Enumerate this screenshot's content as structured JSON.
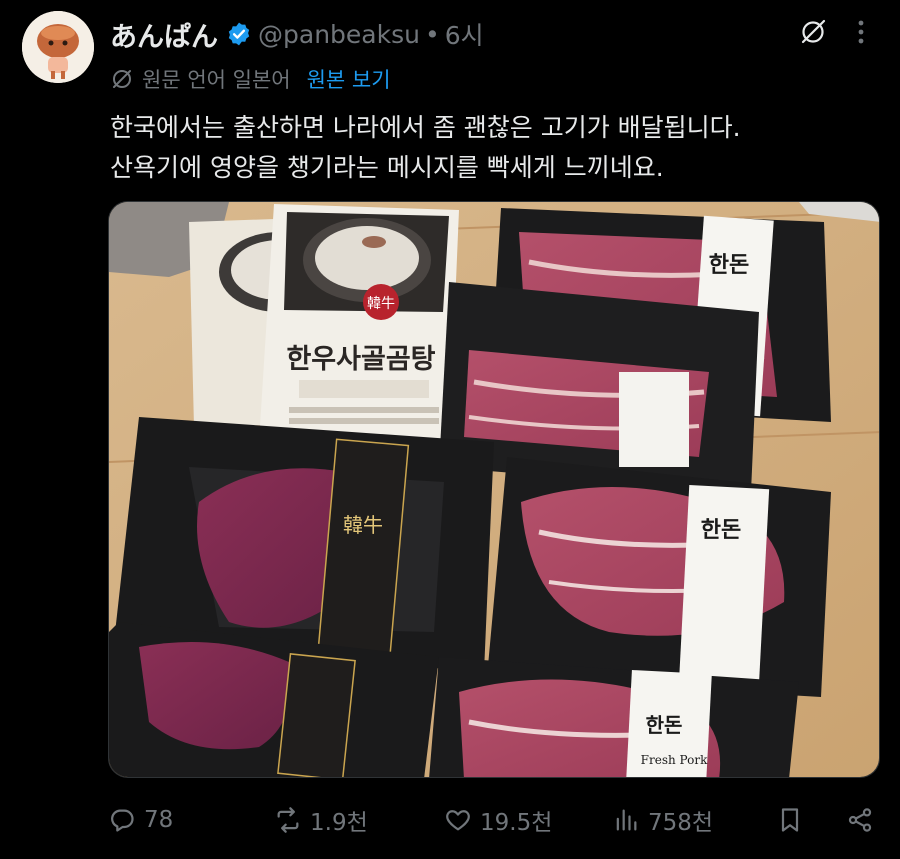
{
  "author": {
    "display_name": "あんぱん",
    "handle": "@panbeaksu",
    "separator": "•",
    "time": "6시",
    "avatar_icon": "anpan-character-avatar",
    "verified_icon": "verified-badge-icon"
  },
  "translation": {
    "note": "원문 언어 일본어",
    "show_original": "원본 보기"
  },
  "tweet": {
    "lines": [
      "한국에서는 출산하면 나라에서 좀 괜찮은 고기가 배달됩니다.",
      "산욕기에 영양을 챙기라는 메시지를 빡세게 느끼네요."
    ]
  },
  "media": {
    "soup_brand": "한우사골곰탕",
    "soup_badge": "韓牛",
    "beef_sleeve": "韓牛",
    "pork_brand": "한돈",
    "pork_label": "Fresh Pork"
  },
  "actions": {
    "reply_count": "78",
    "repost_count": "1.9천",
    "like_count": "19.5천",
    "views_count": "758천"
  },
  "colors": {
    "background": "#000000",
    "text": "#e7e9ea",
    "muted": "#71767b",
    "accent": "#1d9bf0"
  }
}
